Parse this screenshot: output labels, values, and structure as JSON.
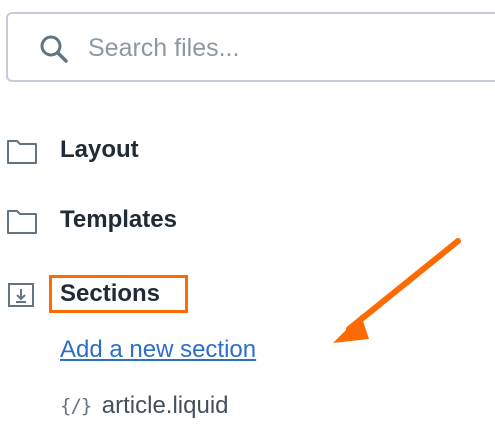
{
  "search": {
    "placeholder": "Search files..."
  },
  "tree": {
    "items": [
      {
        "label": "Layout",
        "icon": "folder-icon"
      },
      {
        "label": "Templates",
        "icon": "folder-icon"
      },
      {
        "label": "Sections",
        "icon": "folder-download-icon",
        "highlighted": true
      }
    ],
    "add_section_link": "Add a new section",
    "files": [
      {
        "icon": "{/}",
        "label": "article.liquid"
      }
    ]
  },
  "colors": {
    "highlight": "#ff6a00",
    "link": "#2c6ecb",
    "text": "#212b36",
    "border": "#c4cdd5"
  }
}
